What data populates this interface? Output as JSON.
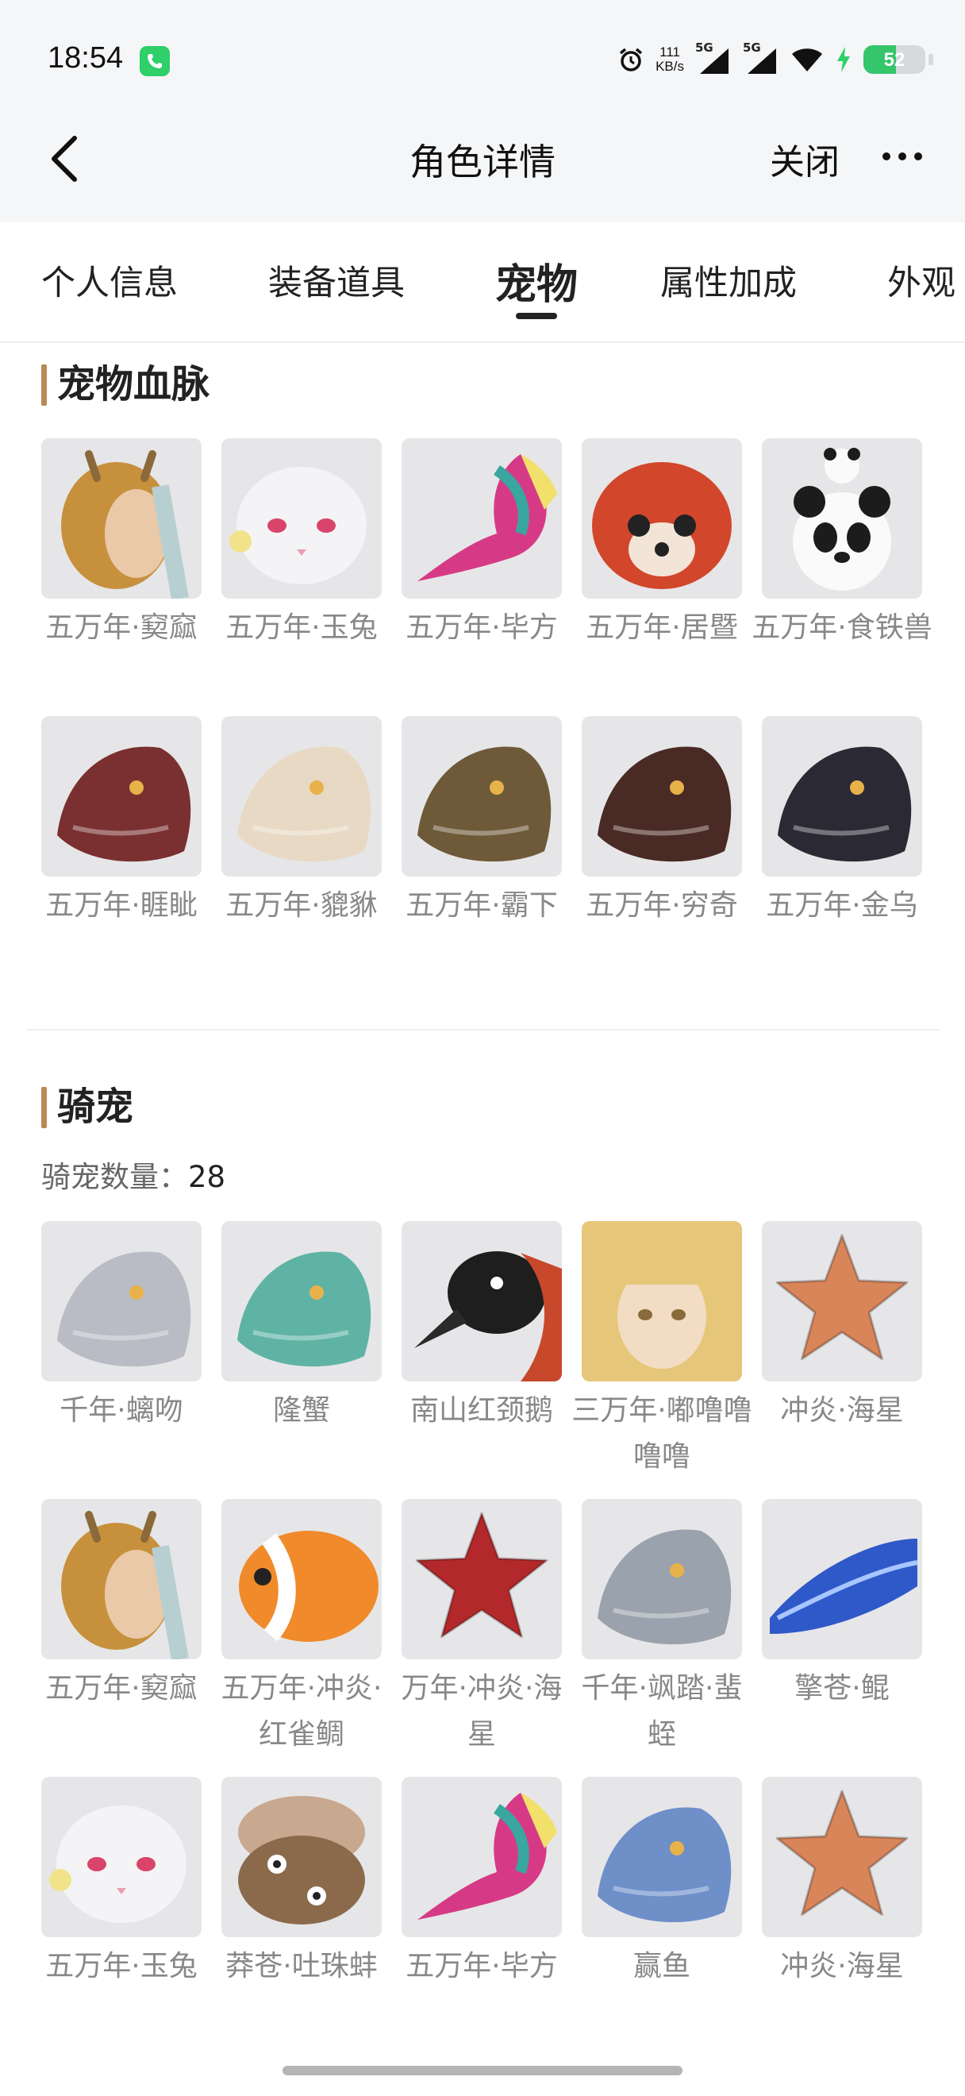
{
  "status_bar": {
    "time": "18:54",
    "net_speed_value": "111",
    "net_speed_unit": "KB/s",
    "signal1_label": "5G",
    "signal2_label": "5G",
    "battery_level": "52",
    "battery_fraction": 0.52
  },
  "header": {
    "title": "角色详情",
    "close_label": "关闭"
  },
  "tabs": [
    {
      "label": "个人信息"
    },
    {
      "label": "装备道具"
    },
    {
      "label": "宠物",
      "active": true
    },
    {
      "label": "属性加成"
    },
    {
      "label": "外观"
    }
  ],
  "pet_bloodline": {
    "title": "宠物血脉",
    "items": [
      {
        "name": "五万年·窫窳",
        "icon": "golden-dragon-girl",
        "color": "#c7903c"
      },
      {
        "name": "五万年·玉兔",
        "icon": "white-rabbit",
        "color": "#f4f4f6"
      },
      {
        "name": "五万年·毕方",
        "icon": "crane-bird",
        "color": "#3aa6a0"
      },
      {
        "name": "五万年·居暨",
        "icon": "red-panda",
        "color": "#d2462b"
      },
      {
        "name": "五万年·食铁兽",
        "icon": "panda",
        "color": "#1c1c1c"
      },
      {
        "name": "五万年·睚眦",
        "icon": "mech-dragon",
        "color": "#7a3030"
      },
      {
        "name": "五万年·貔貅",
        "icon": "lion-mask",
        "color": "#e8d9c4"
      },
      {
        "name": "五万年·霸下",
        "icon": "dragon-head",
        "color": "#6e5a38"
      },
      {
        "name": "五万年·穷奇",
        "icon": "dark-beast",
        "color": "#4a2a24"
      },
      {
        "name": "五万年·金乌",
        "icon": "black-bird",
        "color": "#2b2a34"
      }
    ]
  },
  "mounts": {
    "title": "骑宠",
    "count_label": "骑宠数量：",
    "count": "28",
    "items": [
      {
        "name": "千年·螭吻",
        "icon": "silver-fish-dragon",
        "color": "#b9bcc4"
      },
      {
        "name": "隆蟹",
        "icon": "jade-crab",
        "color": "#5fb3a5"
      },
      {
        "name": "南山红颈鹅",
        "icon": "black-goose",
        "color": "#1e1e1e"
      },
      {
        "name": "三万年·嘟噜噜噜噜",
        "icon": "blonde-girl",
        "color": "#e6c77a"
      },
      {
        "name": "冲炎·海星",
        "icon": "orange-starfish",
        "color": "#d9855a"
      },
      {
        "name": "五万年·窫窳",
        "icon": "golden-dragon-girl",
        "color": "#c7903c"
      },
      {
        "name": "五万年·冲炎·红雀鲷",
        "icon": "clownfish",
        "color": "#f08a2a"
      },
      {
        "name": "万年·冲炎·海星",
        "icon": "red-starfish",
        "color": "#b3282a"
      },
      {
        "name": "千年·飒踏·蜚蛭",
        "icon": "silver-dragon",
        "color": "#9aa3ad"
      },
      {
        "name": "擎苍·鲲",
        "icon": "blue-whale",
        "color": "#2f58c9"
      },
      {
        "name": "五万年·玉兔",
        "icon": "white-rabbit",
        "color": "#f4f4f6"
      },
      {
        "name": "莽苍·吐珠蚌",
        "icon": "clam",
        "color": "#8b6a4c"
      },
      {
        "name": "五万年·毕方",
        "icon": "crane-bird",
        "color": "#3aa6a0"
      },
      {
        "name": "赢鱼",
        "icon": "blue-bird-fish",
        "color": "#6f8fc9"
      },
      {
        "name": "冲炎·海星",
        "icon": "orange-starfish",
        "color": "#d9855a"
      }
    ]
  }
}
